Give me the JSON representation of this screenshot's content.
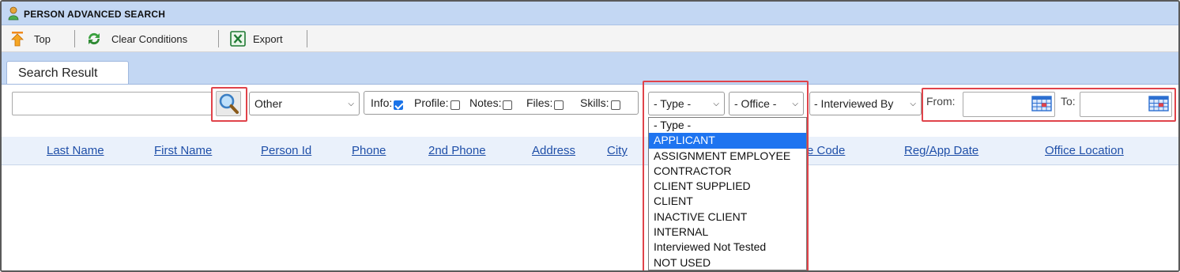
{
  "window": {
    "title": "PERSON ADVANCED SEARCH"
  },
  "toolbar": {
    "top_label": "Top",
    "clear_label": "Clear Conditions",
    "export_label": "Export"
  },
  "tabs": [
    {
      "label": "Search Result"
    }
  ],
  "search": {
    "keyword_value": "",
    "category_selected": "Other",
    "options": {
      "info_label": "Info:",
      "info_checked": true,
      "profile_label": "Profile:",
      "profile_checked": false,
      "notes_label": "Notes:",
      "notes_checked": false,
      "files_label": "Files:",
      "files_checked": false,
      "skills_label": "Skills:",
      "skills_checked": false
    },
    "type_selected": "- Type -",
    "office_selected": "- Office -",
    "interviewed_selected": "- Interviewed By",
    "from_label": "From:",
    "from_value": "",
    "to_label": "To:",
    "to_value": ""
  },
  "table": {
    "columns": [
      "Last Name",
      "First Name",
      "Person Id",
      "Phone",
      "2nd Phone",
      "Address",
      "City",
      "e Code",
      "Reg/App Date",
      "Office Location"
    ]
  },
  "type_dropdown": {
    "highlighted_index": 1,
    "items": [
      "- Type -",
      "APPLICANT",
      "ASSIGNMENT EMPLOYEE",
      "CONTRACTOR",
      "CLIENT SUPPLIED",
      "CLIENT",
      "INACTIVE CLIENT",
      "INTERNAL",
      "Interviewed Not Tested",
      "NOT USED"
    ]
  },
  "colors": {
    "accent_band": "#c3d7f3",
    "highlight_annotation": "#e0434a",
    "link": "#1f4fa8",
    "selection": "#1e74f0"
  }
}
